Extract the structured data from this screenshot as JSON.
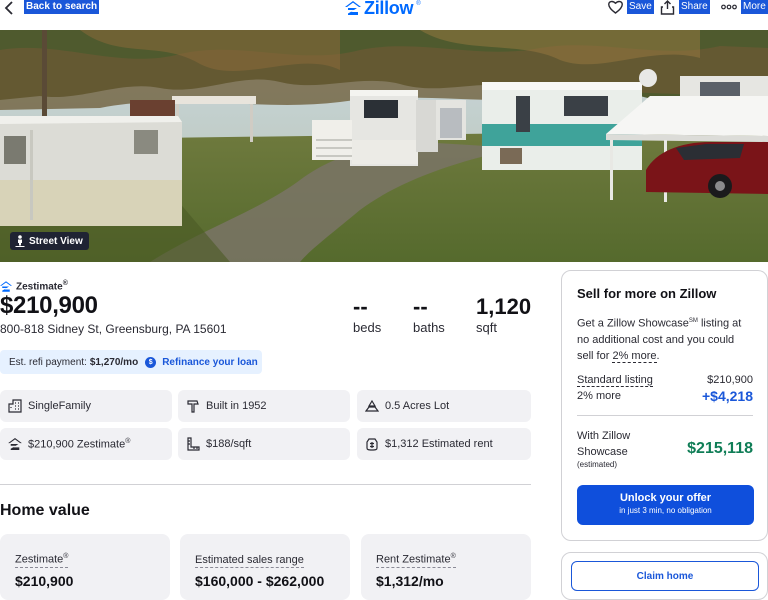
{
  "topbar": {
    "back_label": "Back to search",
    "logo_text": "Zillow",
    "logo_mark": "®",
    "save_label": "Save",
    "share_label": "Share",
    "more_label": "More"
  },
  "hero": {
    "street_view_label": "Street View"
  },
  "summary": {
    "zestimate_label": "Zestimate",
    "price": "$210,900",
    "address": "800-818 Sidney St, Greensburg, PA 15601",
    "beds_value": "--",
    "beds_label": "beds",
    "baths_value": "--",
    "baths_label": "baths",
    "sqft_value": "1,120",
    "sqft_label": "sqft"
  },
  "refi": {
    "label": "Est. refi payment:",
    "amount": "$1,270/mo",
    "badge": "$",
    "link": "Refinance your loan"
  },
  "facts": [
    {
      "icon": "house-icon",
      "text": "SingleFamily"
    },
    {
      "icon": "hammer-icon",
      "text": "Built in 1952"
    },
    {
      "icon": "lot-icon",
      "text": "0.5 Acres Lot"
    },
    {
      "icon": "zillow-mark-icon",
      "text": "$210,900 Zestimate"
    },
    {
      "icon": "ruler-icon",
      "text": "$188/sqft"
    },
    {
      "icon": "rent-icon",
      "text": "$1,312 Estimated rent"
    }
  ],
  "home_value": {
    "title": "Home value",
    "cards": [
      {
        "label": "Zestimate",
        "value": "$210,900"
      },
      {
        "label": "Estimated sales range",
        "value": "$160,000 - $262,000"
      },
      {
        "label": "Rent Zestimate",
        "value": "$1,312/mo"
      }
    ]
  },
  "sell": {
    "title": "Sell for more on Zillow",
    "desc_prefix": "Get a Zillow Showcase",
    "desc_sm": "SM",
    "desc_middle": " listing at no additional cost and you could sell for ",
    "desc_highlight": "2% more",
    "desc_end": ".",
    "standard_label": "Standard listing",
    "standard_value": "$210,900",
    "more_label": "2% more",
    "more_value": "+$4,218",
    "showcase_label_1": "With Zillow",
    "showcase_label_2": "Showcase",
    "showcase_note": "(estimated)",
    "showcase_value": "$215,118",
    "unlock_title": "Unlock your offer",
    "unlock_sub": "in just 3 min, no obligation",
    "claim_label": "Claim home"
  },
  "colors": {
    "brand_blue": "#006aff",
    "link_blue": "#1a57d9",
    "green": "#0f7d56"
  }
}
